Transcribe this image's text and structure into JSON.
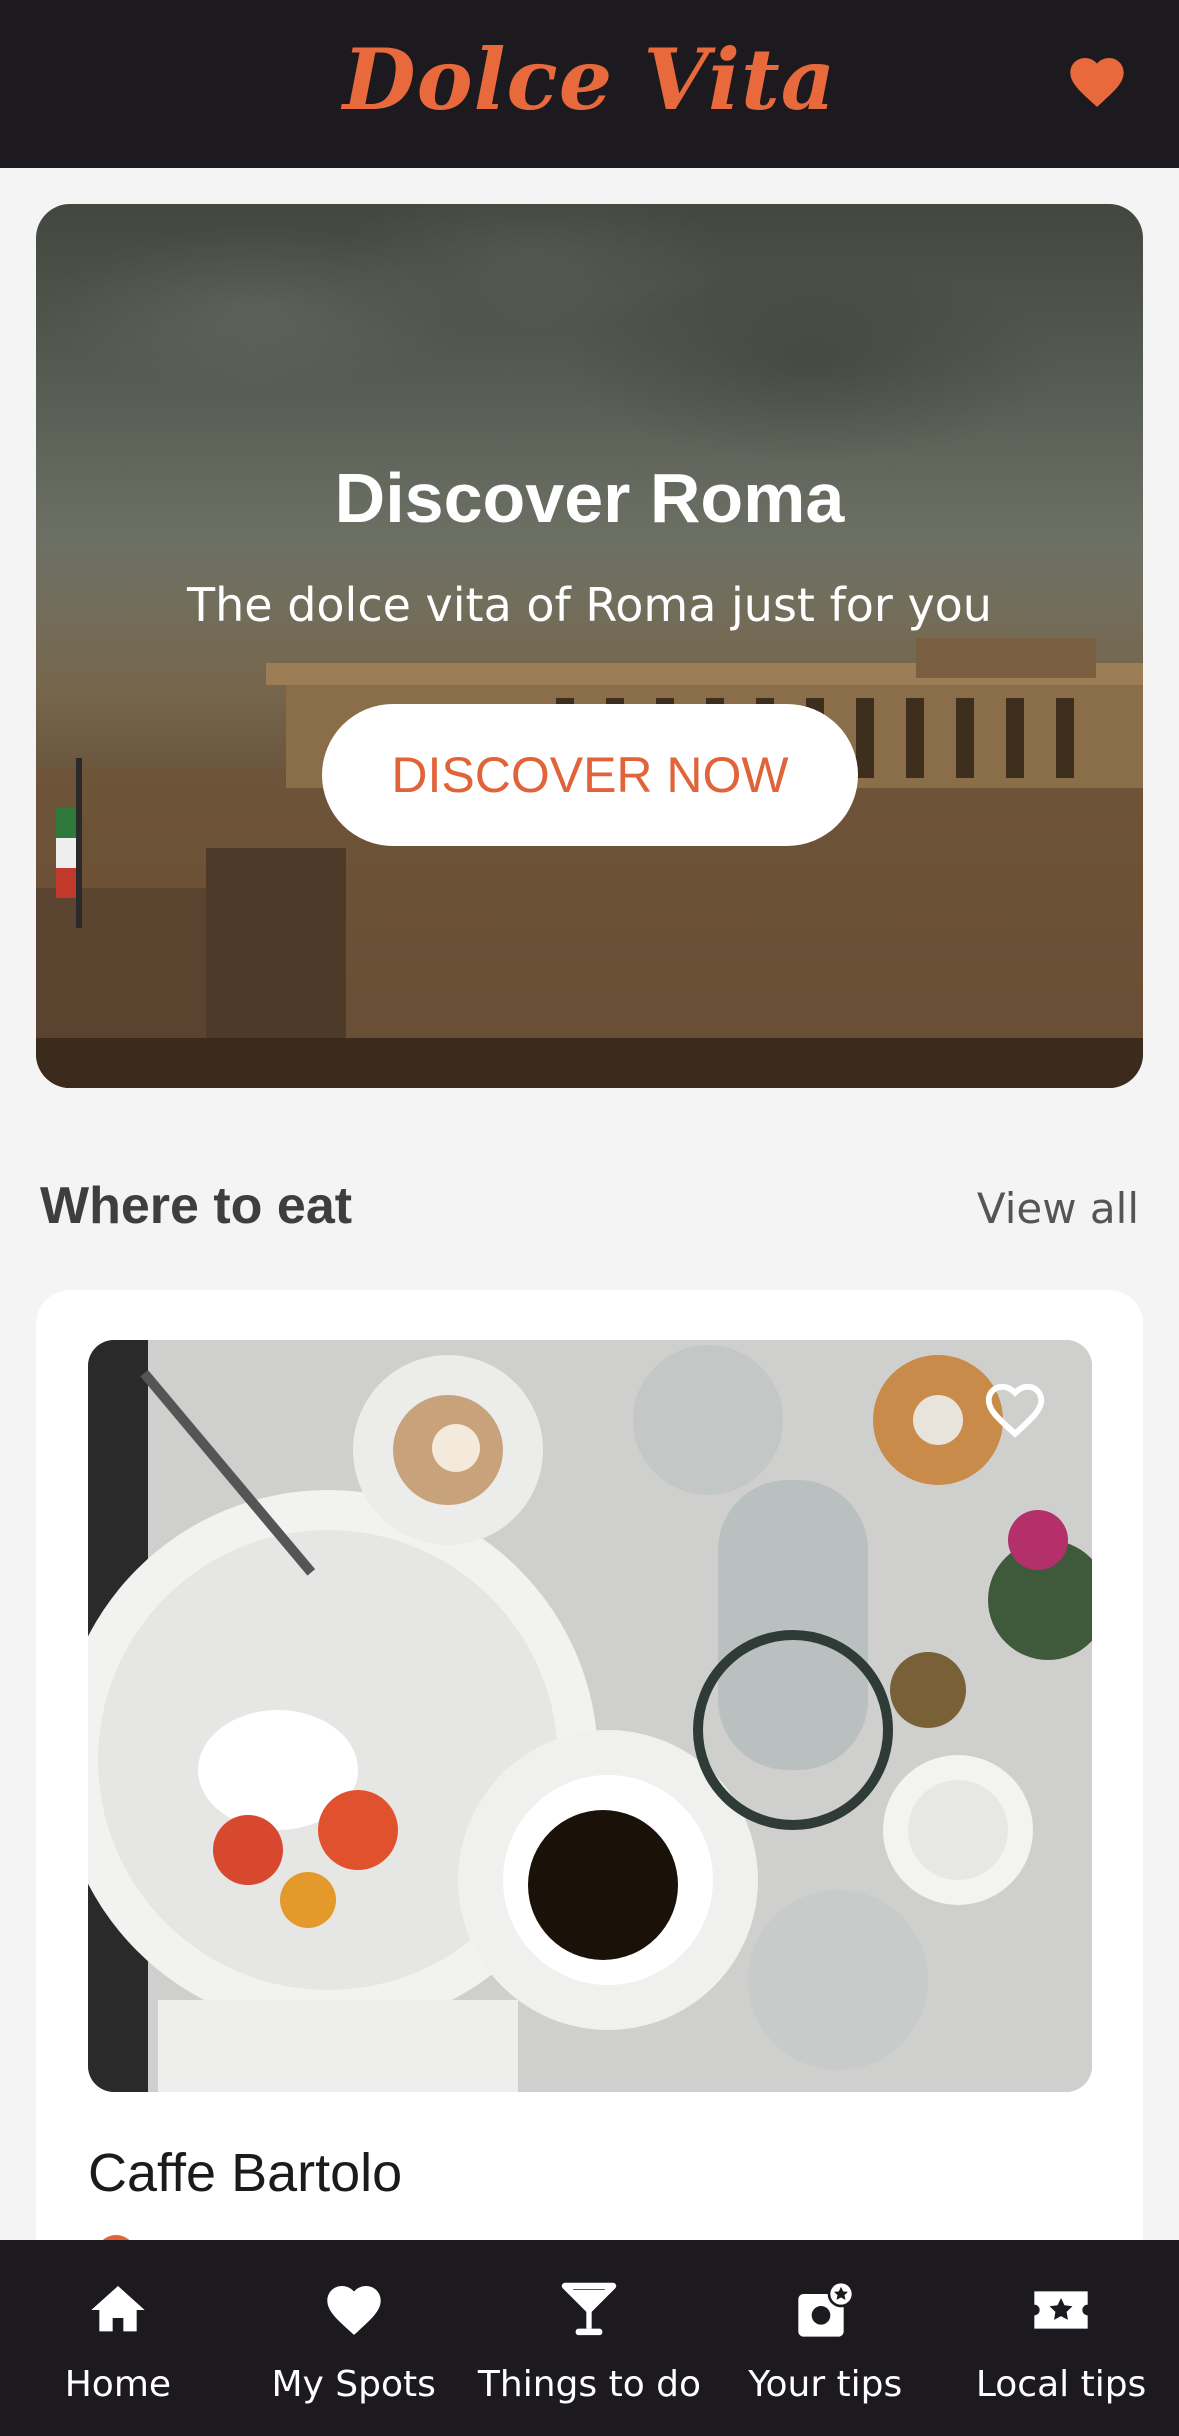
{
  "header": {
    "logo_text": "Dolce Vita",
    "favorite_icon": "heart-icon",
    "accent_color": "#e8693b",
    "bar_color": "#1c1a1f"
  },
  "hero": {
    "title": "Discover Roma",
    "subtitle": "The dolce vita of Roma just for you",
    "button_label": "DISCOVER NOW"
  },
  "section": {
    "title": "Where to eat",
    "view_all_label": "View all"
  },
  "cards": [
    {
      "title": "Caffe Bartolo",
      "favorite_icon": "heart-outline-icon"
    }
  ],
  "bottom_nav": {
    "items": [
      {
        "label": "Home",
        "icon": "home-icon"
      },
      {
        "label": "My Spots",
        "icon": "heart-icon"
      },
      {
        "label": "Things to do",
        "icon": "cocktail-glass-icon"
      },
      {
        "label": "Your tips",
        "icon": "photo-star-icon"
      },
      {
        "label": "Local tips",
        "icon": "ticket-star-icon"
      }
    ]
  }
}
